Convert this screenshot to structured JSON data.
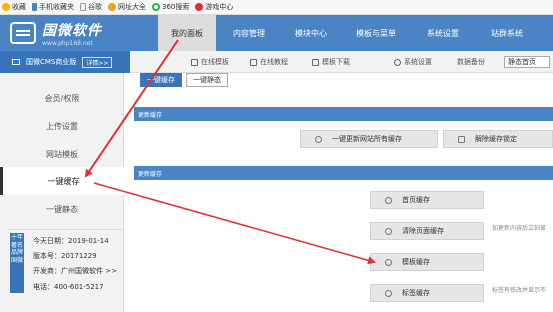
{
  "bookmarks": {
    "items": [
      {
        "label": "收藏",
        "icon": "star-icon"
      },
      {
        "label": "手机收藏夹",
        "icon": "phone-icon"
      },
      {
        "label": "谷歌",
        "icon": "page-icon"
      },
      {
        "label": "网址大全",
        "icon": "globe-icon"
      },
      {
        "label": "360搜索",
        "icon": "search-icon"
      },
      {
        "label": "游戏中心",
        "icon": "game-icon"
      }
    ]
  },
  "header": {
    "logo_title": "国微软件",
    "logo_url": "www.php168.net",
    "tabs": [
      "我的面板",
      "内容管理",
      "模块中心",
      "模板与菜单",
      "系统设置",
      "站群系统"
    ]
  },
  "subbar": {
    "site_name": "国微CMS商业版",
    "detail_label": "详情>>",
    "links": [
      "在线模板",
      "在线教程",
      "模板下载",
      "系统设置",
      "数据备份"
    ],
    "home_select": "静态首页"
  },
  "sidebar": {
    "items": [
      "会员/权限",
      "上传设置",
      "网站模板",
      "一键缓存",
      "一键静态"
    ],
    "active_index": 3,
    "vertical_label": "十年 著名品牌 国微",
    "info": {
      "date": "今天日期：2019-01-14",
      "version": "版本号：20171229",
      "developer": "开发商：广州国微软件 >>",
      "phone": "电话：400-601-5217"
    }
  },
  "main": {
    "top_buttons": [
      "一键缓存",
      "一键静态"
    ],
    "section1_title": "更新缓存",
    "section1_buttons": [
      "一键更新网站所有缓存",
      "解除缓存锁定"
    ],
    "section2_title": "更新缓存",
    "cache_buttons": [
      "首页缓存",
      "清除页面缓存",
      "模板缓存",
      "标签缓存"
    ],
    "notes": [
      "如更新内容后立刻显",
      "标签有修改并显示不"
    ]
  },
  "colors": {
    "header_blue": "#4a84c5",
    "site_blue": "#3a74b8",
    "annotation_red": "#e03030"
  }
}
